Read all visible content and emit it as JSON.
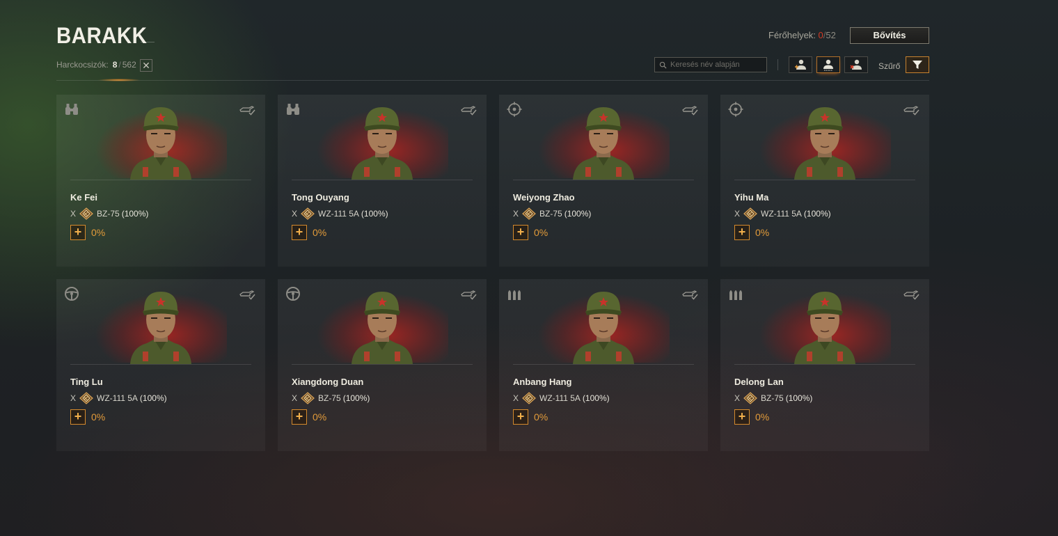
{
  "header": {
    "title": "BARAKK",
    "count_label": "Harckocsizók:",
    "count_current": "8",
    "count_total": "562",
    "capacity_label": "Férőhelyek:",
    "capacity_used": "0",
    "capacity_max": "52",
    "expand_label": "Bővítés",
    "search_placeholder": "Keresés név alapján",
    "filter_label": "Szűrő"
  },
  "colors": {
    "accent": "#d58a2c",
    "capacity_used": "#d33b25",
    "skill_text": "#e29b3a"
  },
  "crew": [
    {
      "name": "Ke Fei",
      "role_icon": "binoculars-icon",
      "tier": "X",
      "vehicle": "BZ-75",
      "percent": "(100%)",
      "skill": "0%"
    },
    {
      "name": "Tong Ouyang",
      "role_icon": "binoculars-icon",
      "tier": "X",
      "vehicle": "WZ-111 5A",
      "percent": "(100%)",
      "skill": "0%"
    },
    {
      "name": "Weiyong Zhao",
      "role_icon": "crosshair-icon",
      "tier": "X",
      "vehicle": "BZ-75",
      "percent": "(100%)",
      "skill": "0%"
    },
    {
      "name": "Yihu Ma",
      "role_icon": "crosshair-icon",
      "tier": "X",
      "vehicle": "WZ-111 5A",
      "percent": "(100%)",
      "skill": "0%"
    },
    {
      "name": "Ting Lu",
      "role_icon": "steering-wheel-icon",
      "tier": "X",
      "vehicle": "WZ-111 5A",
      "percent": "(100%)",
      "skill": "0%"
    },
    {
      "name": "Xiangdong Duan",
      "role_icon": "steering-wheel-icon",
      "tier": "X",
      "vehicle": "BZ-75",
      "percent": "(100%)",
      "skill": "0%"
    },
    {
      "name": "Anbang Hang",
      "role_icon": "shells-icon",
      "tier": "X",
      "vehicle": "WZ-111 5A",
      "percent": "(100%)",
      "skill": "0%"
    },
    {
      "name": "Delong Lan",
      "role_icon": "shells-icon",
      "tier": "X",
      "vehicle": "BZ-75",
      "percent": "(100%)",
      "skill": "0%"
    }
  ]
}
